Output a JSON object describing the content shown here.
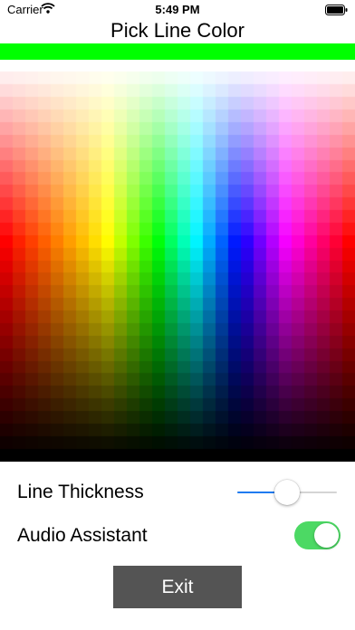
{
  "status_bar": {
    "carrier": "Carrier",
    "time": "5:49 PM"
  },
  "title": "Pick Line Color",
  "selected_color": "#00ff00",
  "palette": {
    "columns": 28,
    "rows": 32
  },
  "thickness": {
    "label": "Line Thickness",
    "value": 0.5,
    "accent_color": "#1f7bf0"
  },
  "audio": {
    "label": "Audio Assistant",
    "enabled": true,
    "on_color": "#4cd964"
  },
  "exit_label": "Exit",
  "icons": {
    "wifi": "wifi-icon",
    "battery": "battery-icon"
  }
}
